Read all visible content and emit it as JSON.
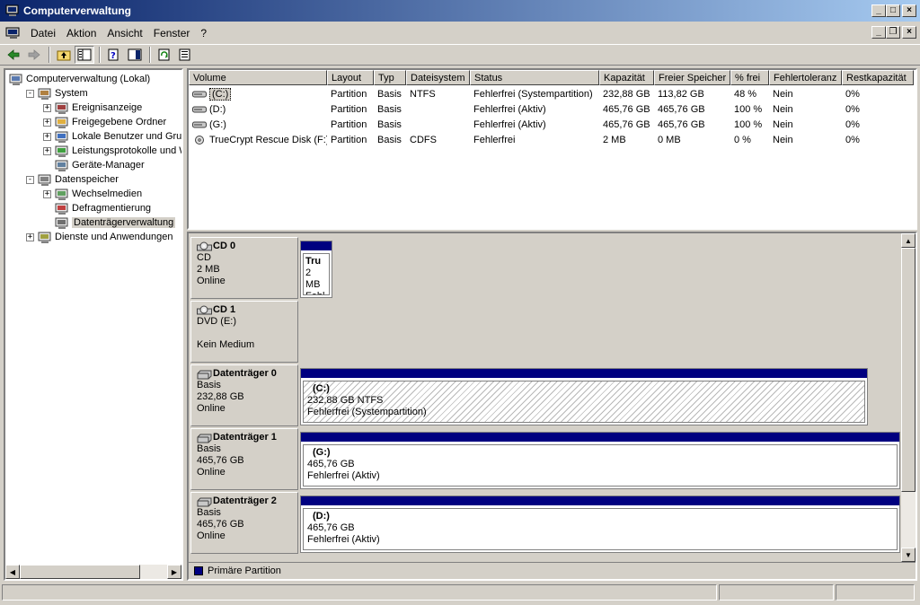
{
  "window": {
    "title": "Computerverwaltung"
  },
  "menu": [
    "Datei",
    "Aktion",
    "Ansicht",
    "Fenster",
    "?"
  ],
  "tree": [
    {
      "label": "Computerverwaltung (Lokal)",
      "level": 0,
      "expander": "",
      "icon": "computer-icon"
    },
    {
      "label": "System",
      "level": 1,
      "expander": "−",
      "icon": "system-tools-icon"
    },
    {
      "label": "Ereignisanzeige",
      "level": 2,
      "expander": "+",
      "icon": "event-viewer-icon"
    },
    {
      "label": "Freigegebene Ordner",
      "level": 2,
      "expander": "+",
      "icon": "shared-folder-icon"
    },
    {
      "label": "Lokale Benutzer und Gruppen",
      "level": 2,
      "expander": "+",
      "icon": "users-icon"
    },
    {
      "label": "Leistungsprotokolle und Warnungen",
      "level": 2,
      "expander": "+",
      "icon": "performance-icon"
    },
    {
      "label": "Geräte-Manager",
      "level": 2,
      "expander": "",
      "icon": "device-manager-icon"
    },
    {
      "label": "Datenspeicher",
      "level": 1,
      "expander": "−",
      "icon": "storage-icon"
    },
    {
      "label": "Wechselmedien",
      "level": 2,
      "expander": "+",
      "icon": "removable-media-icon"
    },
    {
      "label": "Defragmentierung",
      "level": 2,
      "expander": "",
      "icon": "defrag-icon"
    },
    {
      "label": "Datenträgerverwaltung",
      "level": 2,
      "expander": "",
      "icon": "disk-management-icon",
      "selected": true
    },
    {
      "label": "Dienste und Anwendungen",
      "level": 1,
      "expander": "+",
      "icon": "services-icon"
    }
  ],
  "list": {
    "columns": [
      "Volume",
      "Layout",
      "Typ",
      "Dateisystem",
      "Status",
      "Kapazität",
      "Freier Speicher",
      "% frei",
      "Fehlertoleranz",
      "Restkapazität"
    ],
    "rows": [
      [
        "(C:)",
        "Partition",
        "Basis",
        "NTFS",
        "Fehlerfrei (Systempartition)",
        "232,88 GB",
        "113,82 GB",
        "48 %",
        "Nein",
        "0%"
      ],
      [
        "(D:)",
        "Partition",
        "Basis",
        "",
        "Fehlerfrei (Aktiv)",
        "465,76 GB",
        "465,76 GB",
        "100 %",
        "Nein",
        "0%"
      ],
      [
        "(G:)",
        "Partition",
        "Basis",
        "",
        "Fehlerfrei (Aktiv)",
        "465,76 GB",
        "465,76 GB",
        "100 %",
        "Nein",
        "0%"
      ],
      [
        "TrueCrypt Rescue Disk (F:)",
        "Partition",
        "Basis",
        "CDFS",
        "Fehlerfrei",
        "2 MB",
        "0 MB",
        "0 %",
        "Nein",
        "0%"
      ]
    ]
  },
  "disks": [
    {
      "name": "CD 0",
      "line1": "CD",
      "line2": "2 MB",
      "line3": "Online",
      "partition": {
        "name": "Tru",
        "size": "2 MB",
        "status": "Fehl"
      }
    },
    {
      "name": "CD 1",
      "line1": "DVD (E:)",
      "line2": "",
      "line3": "Kein Medium"
    },
    {
      "name": "Datenträger 0",
      "line1": "Basis",
      "line2": "232,88 GB",
      "line3": "Online",
      "partition": {
        "name": "(C:)",
        "size": "232,88 GB NTFS",
        "status": "Fehlerfrei (Systempartition)"
      }
    },
    {
      "name": "Datenträger 1",
      "line1": "Basis",
      "line2": "465,76 GB",
      "line3": "Online",
      "partition": {
        "name": "(G:)",
        "size": "465,76 GB",
        "status": "Fehlerfrei (Aktiv)"
      }
    },
    {
      "name": "Datenträger 2",
      "line1": "Basis",
      "line2": "465,76 GB",
      "line3": "Online",
      "partition": {
        "name": "(D:)",
        "size": "465,76 GB",
        "status": "Fehlerfrei (Aktiv)"
      }
    }
  ],
  "legend": {
    "label": "Primäre Partition",
    "color": "#000080"
  },
  "colors": {
    "title_start": "#0a246a",
    "title_end": "#a6caf0",
    "face": "#d4d0c8",
    "primary_partition": "#000080"
  }
}
